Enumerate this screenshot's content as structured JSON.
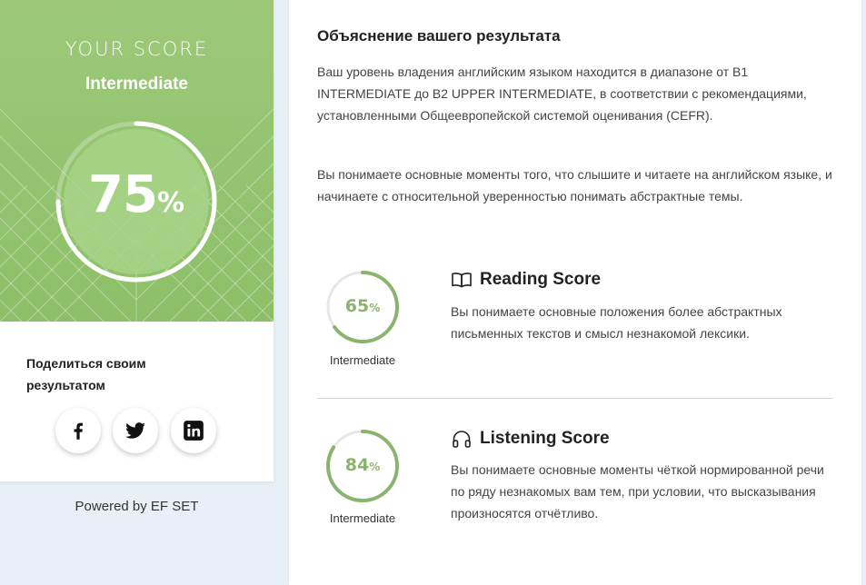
{
  "score_card": {
    "heading": "YOUR SCORE",
    "level": "Intermediate",
    "value": "75",
    "unit": "%",
    "fraction": 0.75
  },
  "share": {
    "title": "Поделиться своим результатом",
    "networks": [
      {
        "name": "facebook",
        "icon": "facebook-icon"
      },
      {
        "name": "twitter",
        "icon": "twitter-icon"
      },
      {
        "name": "linkedin",
        "icon": "linkedin-icon"
      }
    ]
  },
  "footer": {
    "powered": "Powered by EF SET"
  },
  "explanation": {
    "title": "Объяснение вашего результата",
    "para1": "Ваш уровень владения английским языком находится в диапазоне от B1 INTERMEDIATE до B2 UPPER INTERMEDIATE, в соответствии с рекомендациями, установленными Общеевропейской системой оценивания (CEFR).",
    "para2": "Вы понимаете основные моменты того, что слышите и читаете на английском языке, и начинаете с относительной уверенностью понимать абстрактные темы."
  },
  "reading": {
    "icon": "book-icon",
    "title": "Reading Score",
    "value": "65",
    "unit": "%",
    "fraction": 0.65,
    "level": "Intermediate",
    "description": "Вы понимаете основные положения более абстрактных письменных текстов и смысл незнакомой лексики."
  },
  "listening": {
    "icon": "headphones-icon",
    "title": "Listening Score",
    "value": "84",
    "unit": "%",
    "fraction": 0.84,
    "level": "Intermediate",
    "description": "Вы понимаете основные моменты чёткой нормированной речи по ряду незнакомых вам тем, при условии, что высказывания произносятся отчётливо."
  },
  "colors": {
    "panel_green": "#92c26e",
    "gauge_green": "#8ab46c",
    "track_grey": "#e6e6e6",
    "page_bg": "#e9eff7"
  }
}
